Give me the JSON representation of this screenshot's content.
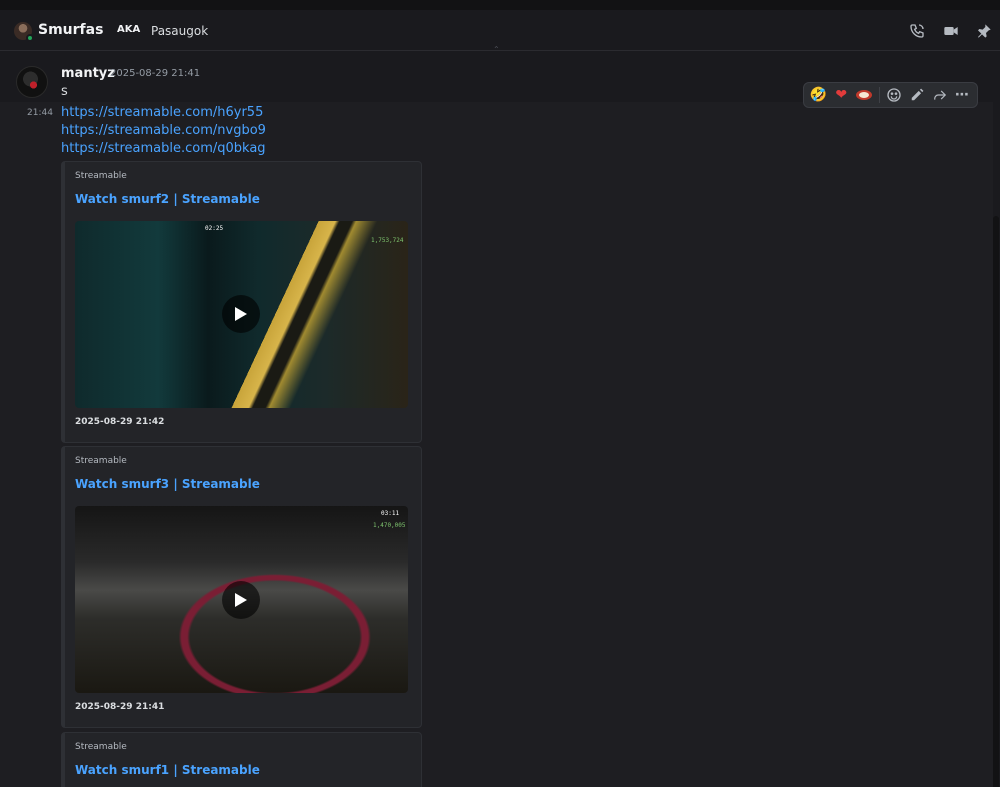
{
  "header": {
    "title": "Smurfas",
    "aka_label": "AKA",
    "aka_name": "Pasaugok",
    "icons": [
      "phone-call-icon",
      "video-call-icon",
      "pin-icon"
    ]
  },
  "message": {
    "author": "mantyz",
    "timestamp": "2025-08-29 21:41",
    "text": "s",
    "followup_time": "21:44",
    "links": [
      "https://streamable.com/h6yr55",
      "https://streamable.com/nvgbo9",
      "https://streamable.com/q0bkag"
    ]
  },
  "toolbar": {
    "items": [
      "rofl-emoji",
      "heart-emoji",
      "steak-emoji",
      "add-reaction-icon",
      "edit-icon",
      "forward-icon",
      "more-icon"
    ]
  },
  "embeds": [
    {
      "provider": "Streamable",
      "title": "Watch smurf2 | Streamable",
      "date": "2025-08-29 21:42",
      "hud_time": "02:25",
      "hud_money": "1,753,724"
    },
    {
      "provider": "Streamable",
      "title": "Watch smurf3 | Streamable",
      "date": "2025-08-29 21:41",
      "hud_time": "03:11",
      "hud_money": "1,470,005"
    },
    {
      "provider": "Streamable",
      "title": "Watch smurf1 | Streamable"
    }
  ],
  "colors": {
    "background": "#1a1a1e",
    "link": "#4aa3ff",
    "status_online": "#23a55a"
  }
}
